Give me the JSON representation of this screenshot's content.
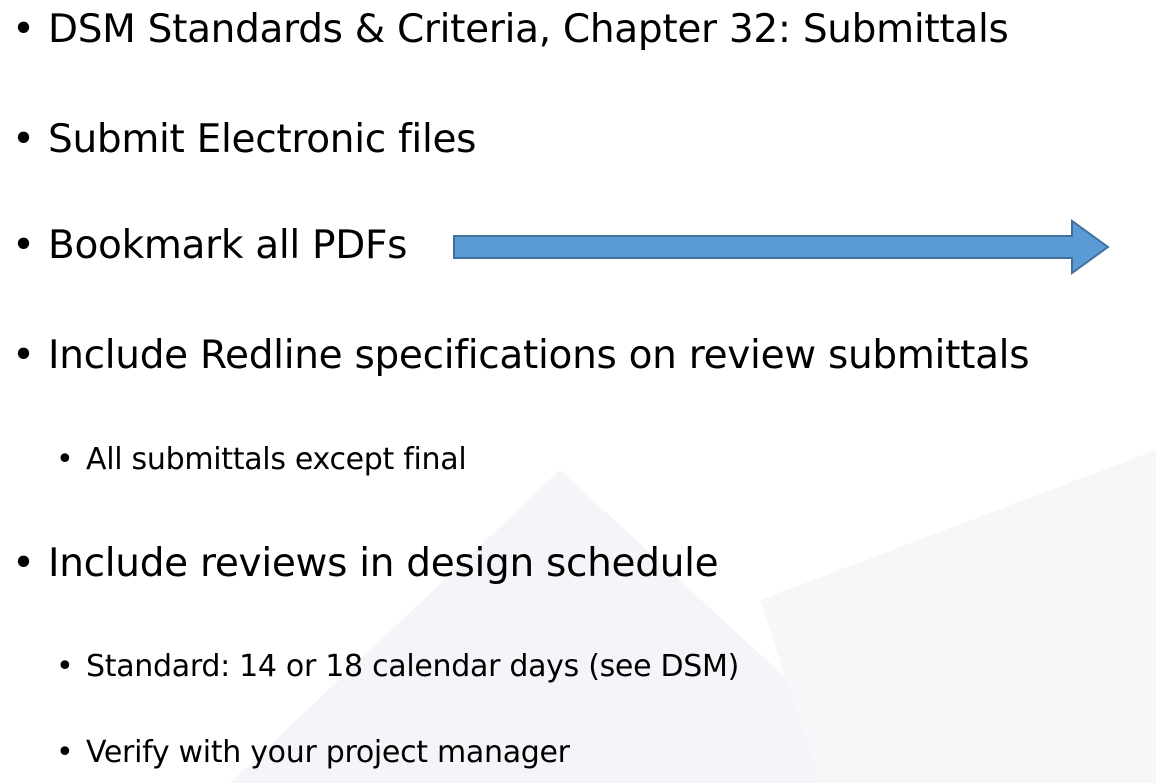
{
  "slide": {
    "bullets": [
      {
        "level": 1,
        "text": "DSM Standards & Criteria, Chapter 32: Submittals"
      },
      {
        "level": 1,
        "text": "Submit Electronic files"
      },
      {
        "level": 1,
        "text": "Bookmark all PDFs"
      },
      {
        "level": 1,
        "text": "Include Redline specifications on review submittals"
      },
      {
        "level": 2,
        "text": "All submittals except final"
      },
      {
        "level": 1,
        "text": "Include reviews in design schedule"
      },
      {
        "level": 2,
        "text": "Standard: 14 or 18 calendar days (see DSM)"
      },
      {
        "level": 2,
        "text": "Verify with your project manager"
      }
    ],
    "bullet_glyph": "•"
  },
  "colors": {
    "arrow_fill": "#5b9bd5",
    "arrow_stroke": "#41719c",
    "text": "#000000",
    "watermark": "#f4f5f8"
  },
  "icons": {
    "arrow": "right-arrow-icon"
  }
}
